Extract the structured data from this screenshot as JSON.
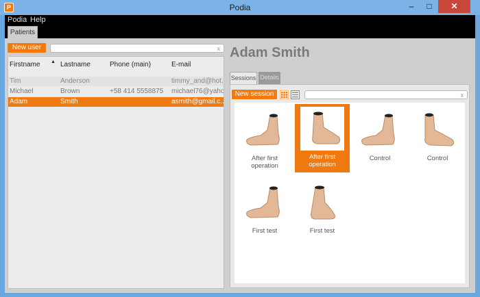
{
  "window": {
    "title": "Podia",
    "app_icon": "P",
    "min_label": "–",
    "max_label": "□",
    "close_label": "✕"
  },
  "menu": [
    "Podia",
    "Help"
  ],
  "main_tab": "Patients",
  "left": {
    "new_user_label": "New user",
    "search_clear": "x",
    "columns": [
      "Firstname",
      "Lastname",
      "Phone (main)",
      "E-mail"
    ],
    "sort_indicator": "▲",
    "rows": [
      {
        "firstname": "Tim",
        "lastname": "Anderson",
        "phone": "",
        "email": "timmy_and@hot..."
      },
      {
        "firstname": "Michael",
        "lastname": "Brown",
        "phone": "+58 414 5558875",
        "email": "michael76@yaho..."
      },
      {
        "firstname": "Adam",
        "lastname": "Smith",
        "phone": "",
        "email": "asmith@gmail.c..."
      }
    ]
  },
  "right": {
    "patient_name": "Adam Smith",
    "tabs": [
      "Sessions",
      "Details"
    ],
    "new_session_label": "New session",
    "search_clear": "x",
    "sessions": [
      {
        "line1": "After first",
        "line2": "operation",
        "selected": false
      },
      {
        "line1": "After first",
        "line2": "operation",
        "selected": true
      },
      {
        "line1": "Control",
        "line2": "",
        "selected": false
      },
      {
        "line1": "Control",
        "line2": "",
        "selected": false
      },
      {
        "line1": "First test",
        "line2": "",
        "selected": false
      },
      {
        "line1": "First test",
        "line2": "",
        "selected": false
      }
    ]
  },
  "colors": {
    "accent": "#f07a10",
    "titlebar": "#7cb3e6",
    "close": "#c7483a",
    "skin": "#e2b896"
  },
  "icons": [
    "app-icon",
    "grid-view-icon",
    "list-view-icon",
    "clear-icon",
    "sort-ascending-icon",
    "foot-icon"
  ]
}
